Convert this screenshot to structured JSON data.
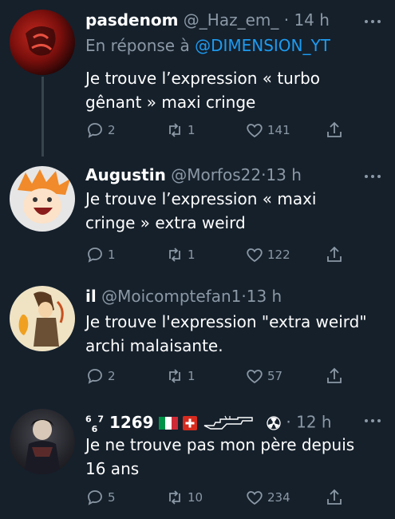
{
  "tweets": [
    {
      "name": "pasdenom",
      "handle": "@_Haz_em_",
      "time": "· 14 h",
      "reply_prefix": "En réponse à",
      "reply_to": "@DIMENSION_YT",
      "text_line1": "Je trouve l’expression « turbo",
      "text_line2": "gênant » maxi cringe",
      "replies": "2",
      "retweets": "1",
      "likes": "141"
    },
    {
      "name": "Augustin",
      "handle": "@Morfos22",
      "time": "·13 h",
      "text_line1": "Je trouve l’expression « maxi",
      "text_line2": "cringe » extra weird",
      "replies": "1",
      "retweets": "1",
      "likes": "122"
    },
    {
      "name": "il",
      "handle": "@Moicomptefan1",
      "time": "·13 h",
      "text_line1": "Je trouve l'expression \"extra weird\"",
      "text_line2": "archi malaisante.",
      "replies": "2",
      "retweets": "1",
      "likes": "57"
    },
    {
      "name_sup1": "6",
      "name_sub": "6",
      "name_sup2": "7",
      "name": "1269",
      "time": "· 12 h",
      "text_line1": "Je ne trouve pas mon père depuis",
      "text_line2": "16 ans",
      "replies": "5",
      "retweets": "10",
      "likes": "234"
    }
  ],
  "colors": {
    "background": "#15202b",
    "secondary_text": "#8b98a5",
    "accent": "#1d9bf0",
    "thread_line": "#38444d"
  },
  "icons": [
    "reply-icon",
    "retweet-icon",
    "like-icon",
    "share-icon",
    "more-icon",
    "italy-flag-icon",
    "swiss-flag-icon",
    "rifle-icon",
    "radiation-icon"
  ]
}
